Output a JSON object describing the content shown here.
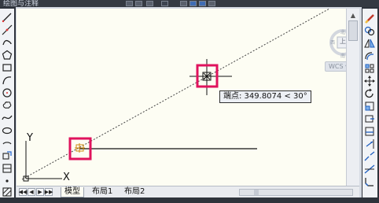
{
  "title_bar": {
    "text": "绘图与注释"
  },
  "canvas": {
    "background": "#fdfdf3",
    "highlight_color": "#e0135d",
    "ucs_labels": {
      "x_axis": "X",
      "y_axis": "Y"
    }
  },
  "tooltip": {
    "text": "端点: 349.8074 < 30°"
  },
  "viewcube": {
    "center_label": "上",
    "wcs_label": "WCS ▾"
  },
  "layout_tabs": {
    "tabs": [
      {
        "label": "模型",
        "active": true
      },
      {
        "label": "布局1",
        "active": false
      },
      {
        "label": "布局2",
        "active": false
      }
    ],
    "nav_buttons": [
      "◀◀",
      "◀",
      "▶",
      "▶▶"
    ]
  },
  "left_toolbar": {
    "tools": [
      "line-icon",
      "construction-line-icon",
      "polyline-icon",
      "polygon-icon",
      "rectangle-icon",
      "arc-icon",
      "circle-icon",
      "revision-cloud-icon",
      "spline-icon",
      "ellipse-icon",
      "ellipse-arc-icon",
      "insert-block-icon",
      "make-block-icon",
      "point-icon",
      "hatch-icon"
    ]
  },
  "right_toolbar": {
    "tools": [
      "erase-icon",
      "copy-icon",
      "mirror-icon",
      "offset-icon",
      "array-icon",
      "move-icon",
      "rotate-icon",
      "scale-icon",
      "stretch-icon",
      "trim-icon",
      "extend-icon",
      "break-icon",
      "join-icon",
      "chamfer-icon"
    ]
  }
}
